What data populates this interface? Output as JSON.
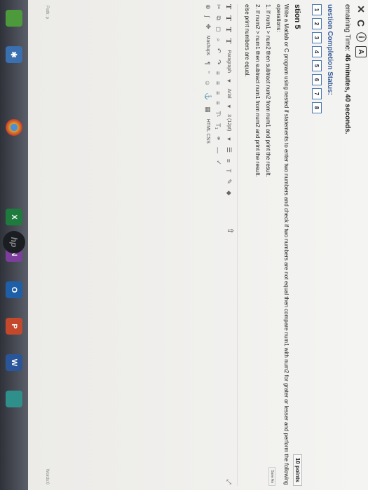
{
  "timer": {
    "label": "emaining Time:",
    "value": "46 minutes, 40 seconds."
  },
  "question_status": {
    "label": "uestion Completion Status:",
    "numbers": [
      "1",
      "2",
      "3",
      "4",
      "5",
      "6",
      "7",
      "8"
    ]
  },
  "question": {
    "title": "stion 5",
    "points": "10 points",
    "save": "Save An",
    "intro": "Write a Matlab or C program using nested if statements to enter two numbers and check if two numbers are not equal then compare num1 with num2 for grater or lesser and perform the following operations:",
    "line1": "1. If num1 > num2 then subtract num2 from num1 and print the result.",
    "line2": "2. If num2 > num1 then subtract num1 from num2 and print the result.",
    "line3": "else print numbers are equal."
  },
  "editor": {
    "format_buttons": [
      "T",
      "T",
      "T",
      "T"
    ],
    "paragraph": "Paragraph",
    "font": "Arial",
    "size": "3 (12pt)",
    "mashups": "Mashups",
    "path_label": "Path: p",
    "words_label": "Words:0",
    "html_css": "HTML CSS"
  },
  "taskbar": {
    "apps": [
      {
        "name": "store",
        "letter": "",
        "color": "#4c9a3c"
      },
      {
        "name": "settings",
        "letter": "✱",
        "color": "#3a6fb0"
      },
      {
        "name": "blank",
        "letter": "",
        "color": "transparent"
      },
      {
        "name": "chrome",
        "letter": "",
        "color": "#d9a32a"
      },
      {
        "name": "excel",
        "letter": "X",
        "color": "#1f7a3e"
      },
      {
        "name": "onenote",
        "letter": "N",
        "color": "#7b3e9b"
      },
      {
        "name": "outlook",
        "letter": "O",
        "color": "#1f5fa8"
      },
      {
        "name": "powerpoint",
        "letter": "P",
        "color": "#c4482b"
      },
      {
        "name": "word",
        "letter": "W",
        "color": "#2a5699"
      },
      {
        "name": "photos",
        "letter": "",
        "color": "#2f8f8a"
      }
    ],
    "logo": "hp"
  }
}
